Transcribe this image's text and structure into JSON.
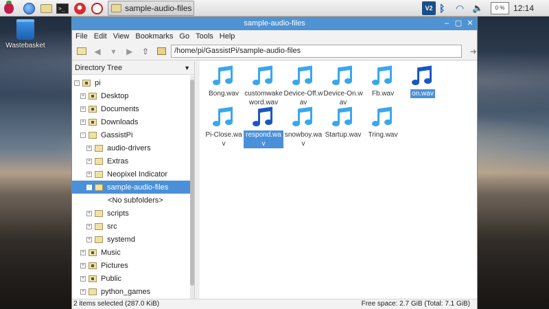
{
  "taskbar": {
    "task_label": "sample-audio-files",
    "vnc_label": "V2",
    "cpu_label": "0 %",
    "clock": "12:14"
  },
  "desktop": {
    "trash_label": "Wastebasket"
  },
  "window": {
    "title": "sample-audio-files",
    "menu": [
      "File",
      "Edit",
      "View",
      "Bookmarks",
      "Go",
      "Tools",
      "Help"
    ],
    "path": "/home/pi/GassistPi/sample-audio-files"
  },
  "sidebar": {
    "header": "Directory Tree",
    "items": [
      {
        "label": "pi",
        "exp": "-"
      },
      {
        "label": "Desktop",
        "exp": "+"
      },
      {
        "label": "Documents",
        "exp": "+"
      },
      {
        "label": "Downloads",
        "exp": "+"
      },
      {
        "label": "GassistPi",
        "exp": "-"
      },
      {
        "label": "audio-drivers",
        "exp": "+"
      },
      {
        "label": "Extras",
        "exp": "+"
      },
      {
        "label": "Neopixel Indicator",
        "exp": "+"
      },
      {
        "label": "sample-audio-files",
        "exp": "-"
      },
      {
        "label": "<No subfolders>",
        "exp": ""
      },
      {
        "label": "scripts",
        "exp": "+"
      },
      {
        "label": "src",
        "exp": "+"
      },
      {
        "label": "systemd",
        "exp": "+"
      },
      {
        "label": "Music",
        "exp": "+"
      },
      {
        "label": "Pictures",
        "exp": "+"
      },
      {
        "label": "Public",
        "exp": "+"
      },
      {
        "label": "python_games",
        "exp": "+"
      }
    ]
  },
  "files": [
    {
      "name": "Bong.wav"
    },
    {
      "name": "customwakeword.wav"
    },
    {
      "name": "Device-Off.wav"
    },
    {
      "name": "Device-On.wav"
    },
    {
      "name": "Fb.wav"
    },
    {
      "name": "on.wav"
    },
    {
      "name": "Pi-Close.wav"
    },
    {
      "name": "respond.wav"
    },
    {
      "name": "snowboy.wav"
    },
    {
      "name": "Startup.wav"
    },
    {
      "name": "Tring.wav"
    }
  ],
  "status": {
    "left": "2 items selected (287.0 KiB)",
    "right": "Free space: 2.7 GiB (Total: 7.1 GiB)"
  },
  "colors": {
    "titlebar": "#4f93d2",
    "selection": "#4a90d9",
    "audio_icon": "#39a7ec",
    "audio_icon_selected": "#1a57c4"
  }
}
